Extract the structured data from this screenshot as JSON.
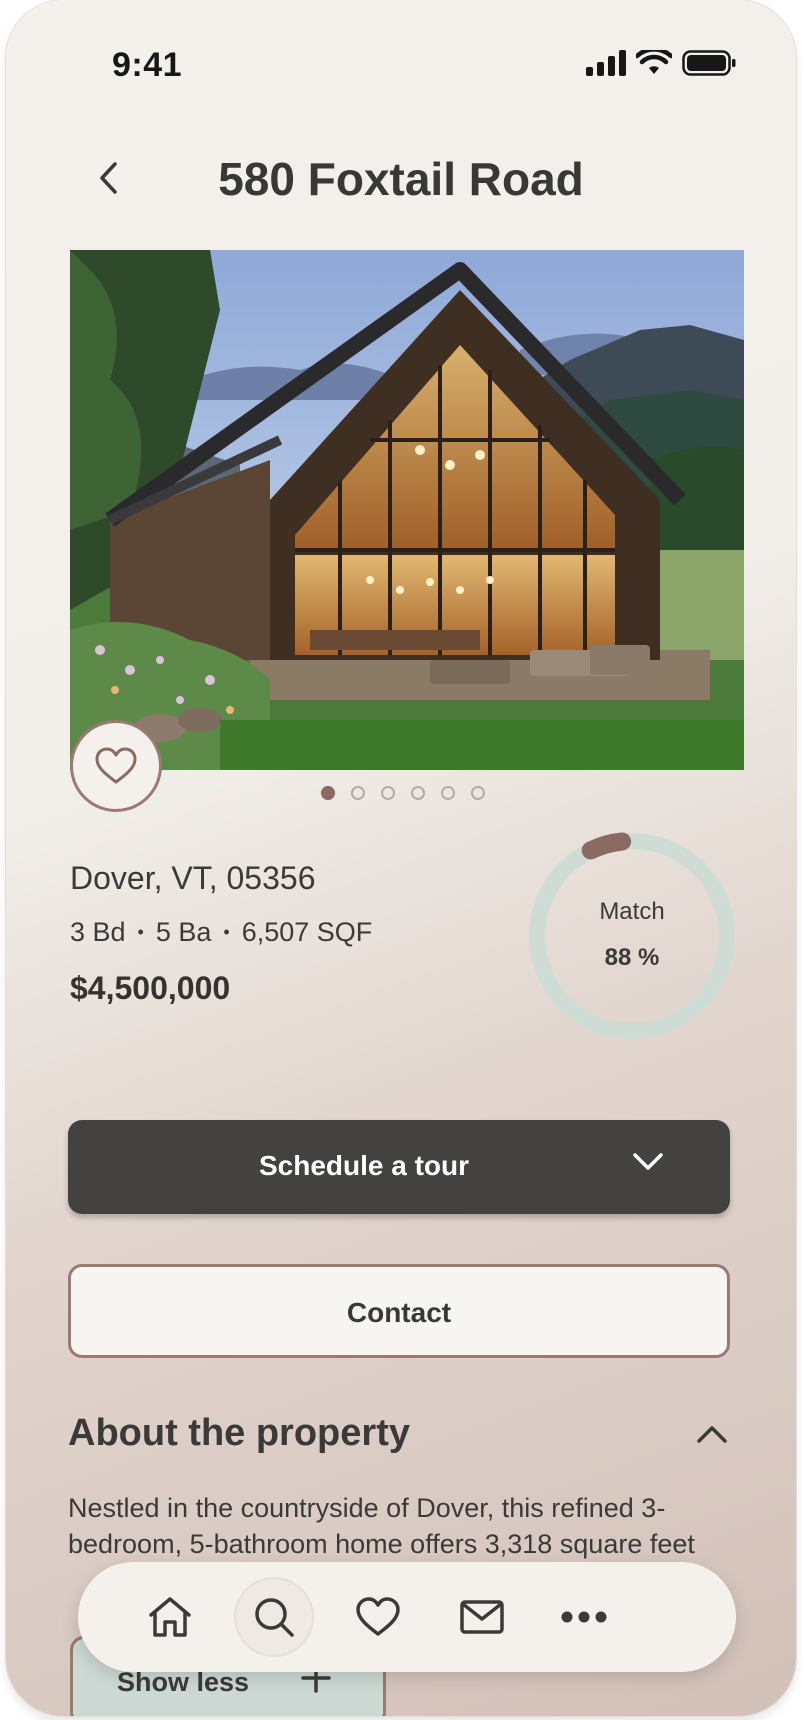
{
  "status": {
    "time": "9:41"
  },
  "header": {
    "title": "580 Foxtail Road"
  },
  "listing": {
    "location": "Dover, VT, 05356",
    "beds": "3 Bd",
    "baths": "5 Ba",
    "area": "6,507 SQF",
    "separator": "•",
    "price": "$4,500,000",
    "photo_count": 6,
    "active_photo": 1
  },
  "match": {
    "label": "Match",
    "value": "88 %",
    "percent": 88
  },
  "actions": {
    "tour_label": "Schedule a tour",
    "contact_label": "Contact"
  },
  "about": {
    "heading": "About the property",
    "description": "Nestled in the countryside of Dover, this refined 3-bedroom, 5-bathroom home offers 3,318 square feet",
    "show_less_label": "Show less"
  },
  "nav": {
    "items": [
      "home-icon",
      "search-icon",
      "heart-icon",
      "mail-icon",
      "more-icon"
    ],
    "active": "search-icon"
  },
  "colors": {
    "accent": "#8a6a63",
    "button_dark": "#434241",
    "ring": "#cfdcd6",
    "background": "#f4f1ec"
  }
}
